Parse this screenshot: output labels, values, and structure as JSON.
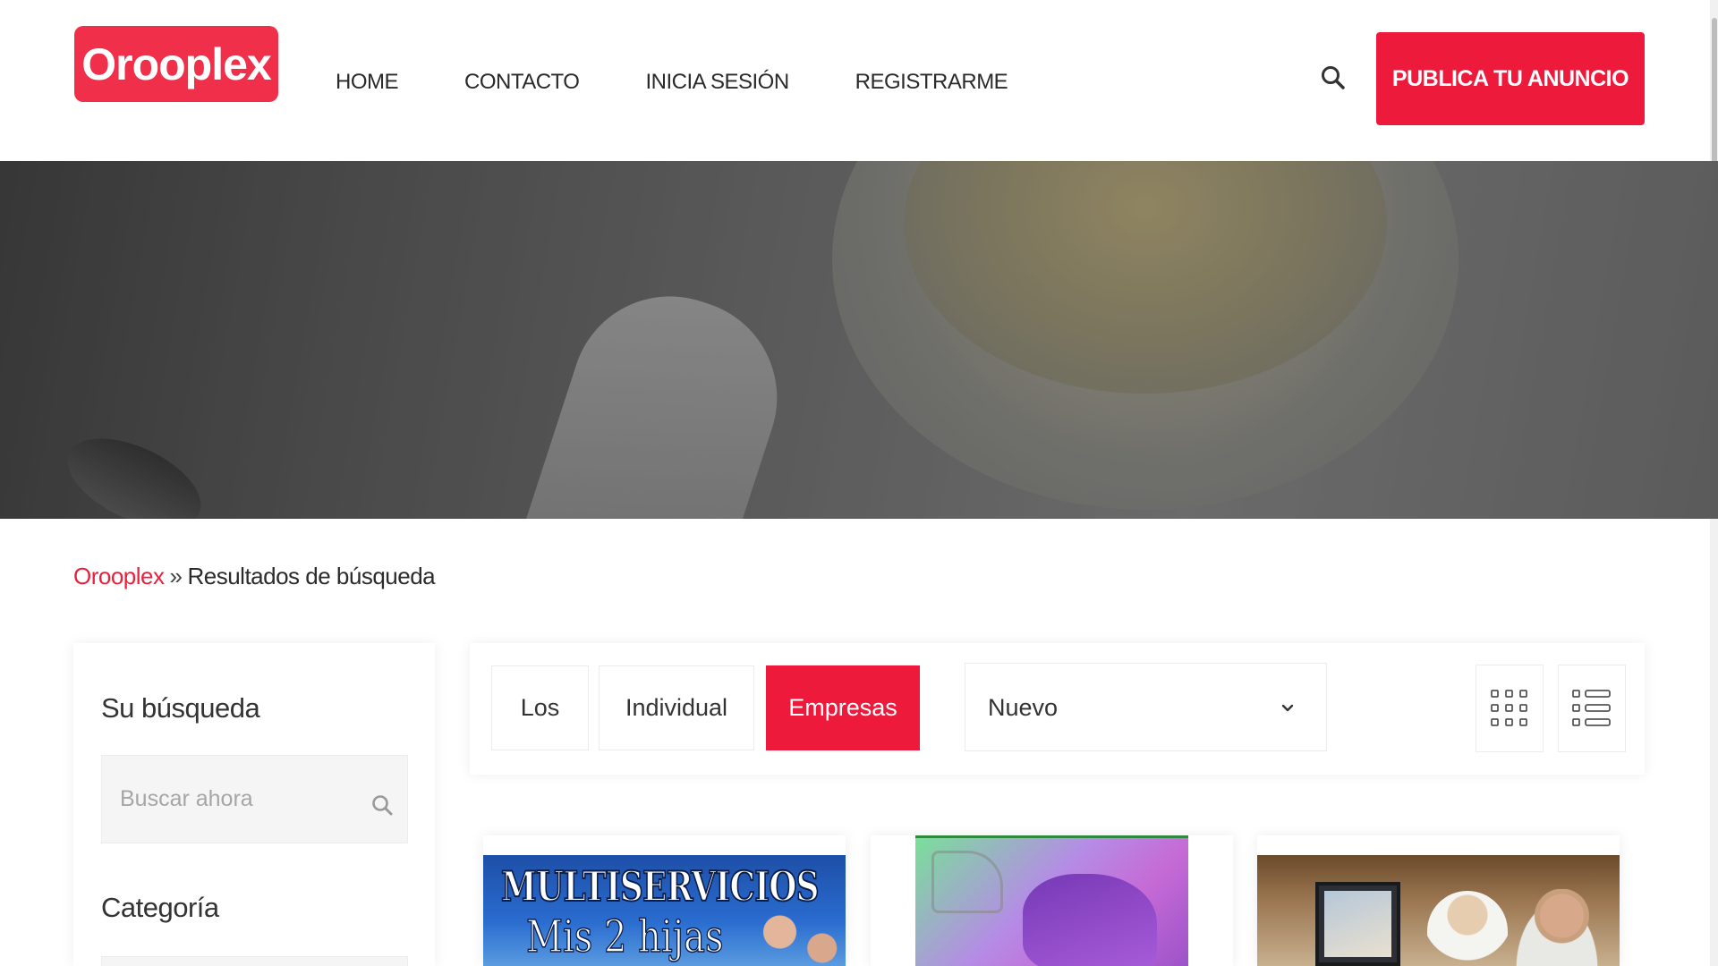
{
  "brand": {
    "logo_text": "Orooplex",
    "accent_color": "#ee1a3c"
  },
  "nav": {
    "items": [
      "HOME",
      "CONTACTO",
      "INICIA SESIÓN",
      "REGISTRARME"
    ]
  },
  "header": {
    "search_icon": "search-icon",
    "publish_button": "PUBLICA TU ANUNCIO"
  },
  "breadcrumb": {
    "home": "Orooplex",
    "separator": "»",
    "current": "Resultados de búsqueda"
  },
  "sidebar": {
    "search_title": "Su búsqueda",
    "search_placeholder": "Buscar ahora",
    "search_value": "",
    "category_title": "Categoría"
  },
  "filters": {
    "tabs": [
      {
        "label": "Los",
        "active": false
      },
      {
        "label": "Individual",
        "active": false
      },
      {
        "label": "Empresas",
        "active": true
      }
    ],
    "sort": {
      "selected": "Nuevo"
    },
    "views": [
      "grid-view-icon",
      "list-view-icon"
    ]
  },
  "cards": [
    {
      "line1": "MULTISERVICIOS",
      "line2": "Mis 2 hijas"
    },
    {
      "image": "sneaker-promo-image"
    },
    {
      "image": "restaurant-photo"
    }
  ]
}
